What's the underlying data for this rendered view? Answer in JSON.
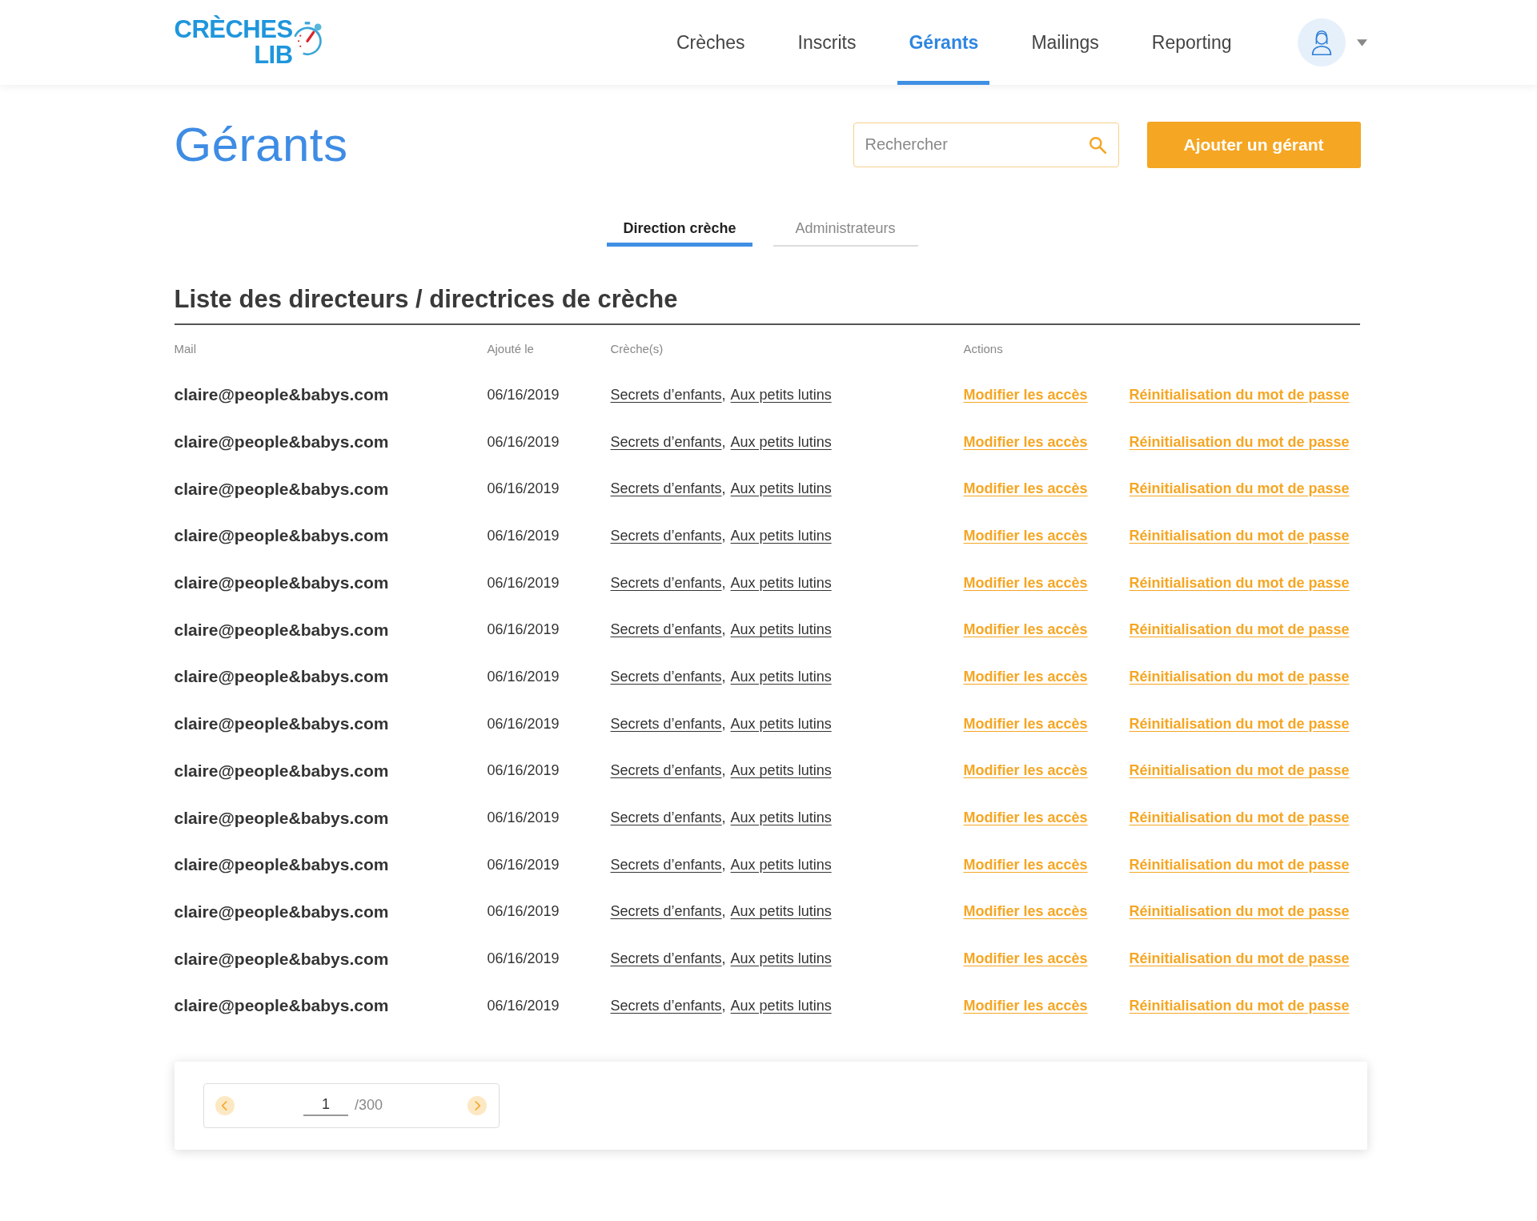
{
  "logo": {
    "line1": "CRÈCHES",
    "line2": "LIB"
  },
  "nav": [
    {
      "label": "Crèches",
      "selected": false
    },
    {
      "label": "Inscrits",
      "selected": false
    },
    {
      "label": "Gérants",
      "selected": true
    },
    {
      "label": "Mailings",
      "selected": false
    },
    {
      "label": "Reporting",
      "selected": false
    }
  ],
  "page_title": "Gérants",
  "search": {
    "placeholder": "Rechercher"
  },
  "add_button": "Ajouter un gérant",
  "tabs": [
    {
      "label": "Direction crèche",
      "selected": true
    },
    {
      "label": "Administrateurs",
      "selected": false
    }
  ],
  "section_title": "Liste des directeurs / directrices de crèche",
  "table": {
    "columns": [
      "Mail",
      "Ajouté le",
      "Crèche(s)",
      "Actions"
    ],
    "creche_separator": ",",
    "rows": [
      {
        "mail": "claire@people&babys.com",
        "added": "06/16/2019",
        "creches": [
          "Secrets d’enfants",
          "Aux petits lutins"
        ],
        "actions": [
          "Modifier les accès",
          "Réinitialisation du mot de passe"
        ]
      },
      {
        "mail": "claire@people&babys.com",
        "added": "06/16/2019",
        "creches": [
          "Secrets d’enfants",
          "Aux petits lutins"
        ],
        "actions": [
          "Modifier les accès",
          "Réinitialisation du mot de passe"
        ]
      },
      {
        "mail": "claire@people&babys.com",
        "added": "06/16/2019",
        "creches": [
          "Secrets d’enfants",
          "Aux petits lutins"
        ],
        "actions": [
          "Modifier les accès",
          "Réinitialisation du mot de passe"
        ]
      },
      {
        "mail": "claire@people&babys.com",
        "added": "06/16/2019",
        "creches": [
          "Secrets d’enfants",
          "Aux petits lutins"
        ],
        "actions": [
          "Modifier les accès",
          "Réinitialisation du mot de passe"
        ]
      },
      {
        "mail": "claire@people&babys.com",
        "added": "06/16/2019",
        "creches": [
          "Secrets d’enfants",
          "Aux petits lutins"
        ],
        "actions": [
          "Modifier les accès",
          "Réinitialisation du mot de passe"
        ]
      },
      {
        "mail": "claire@people&babys.com",
        "added": "06/16/2019",
        "creches": [
          "Secrets d’enfants",
          "Aux petits lutins"
        ],
        "actions": [
          "Modifier les accès",
          "Réinitialisation du mot de passe"
        ]
      },
      {
        "mail": "claire@people&babys.com",
        "added": "06/16/2019",
        "creches": [
          "Secrets d’enfants",
          "Aux petits lutins"
        ],
        "actions": [
          "Modifier les accès",
          "Réinitialisation du mot de passe"
        ]
      },
      {
        "mail": "claire@people&babys.com",
        "added": "06/16/2019",
        "creches": [
          "Secrets d’enfants",
          "Aux petits lutins"
        ],
        "actions": [
          "Modifier les accès",
          "Réinitialisation du mot de passe"
        ]
      },
      {
        "mail": "claire@people&babys.com",
        "added": "06/16/2019",
        "creches": [
          "Secrets d’enfants",
          "Aux petits lutins"
        ],
        "actions": [
          "Modifier les accès",
          "Réinitialisation du mot de passe"
        ]
      },
      {
        "mail": "claire@people&babys.com",
        "added": "06/16/2019",
        "creches": [
          "Secrets d’enfants",
          "Aux petits lutins"
        ],
        "actions": [
          "Modifier les accès",
          "Réinitialisation du mot de passe"
        ]
      },
      {
        "mail": "claire@people&babys.com",
        "added": "06/16/2019",
        "creches": [
          "Secrets d’enfants",
          "Aux petits lutins"
        ],
        "actions": [
          "Modifier les accès",
          "Réinitialisation du mot de passe"
        ]
      },
      {
        "mail": "claire@people&babys.com",
        "added": "06/16/2019",
        "creches": [
          "Secrets d’enfants",
          "Aux petits lutins"
        ],
        "actions": [
          "Modifier les accès",
          "Réinitialisation du mot de passe"
        ]
      },
      {
        "mail": "claire@people&babys.com",
        "added": "06/16/2019",
        "creches": [
          "Secrets d’enfants",
          "Aux petits lutins"
        ],
        "actions": [
          "Modifier les accès",
          "Réinitialisation du mot de passe"
        ]
      },
      {
        "mail": "claire@people&babys.com",
        "added": "06/16/2019",
        "creches": [
          "Secrets d’enfants",
          "Aux petits lutins"
        ],
        "actions": [
          "Modifier les accès",
          "Réinitialisation du mot de passe"
        ]
      }
    ]
  },
  "pagination": {
    "page": "1",
    "total": "/300"
  }
}
